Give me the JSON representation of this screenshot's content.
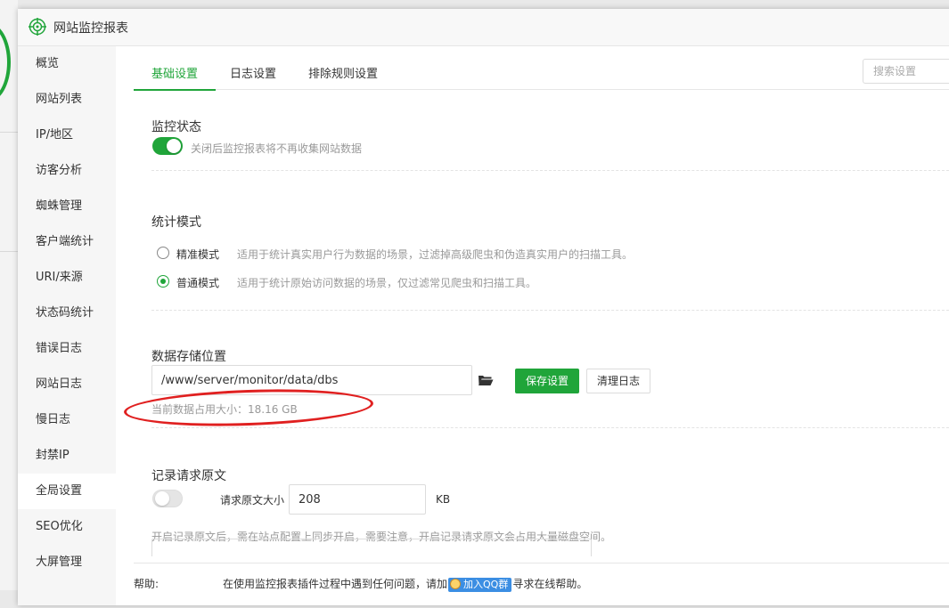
{
  "window": {
    "title": "网站监控报表"
  },
  "sidebar": {
    "items": [
      {
        "label": "概览"
      },
      {
        "label": "网站列表"
      },
      {
        "label": "IP/地区"
      },
      {
        "label": "访客分析"
      },
      {
        "label": "蜘蛛管理"
      },
      {
        "label": "客户端统计"
      },
      {
        "label": "URI/来源"
      },
      {
        "label": "状态码统计"
      },
      {
        "label": "错误日志"
      },
      {
        "label": "网站日志"
      },
      {
        "label": "慢日志"
      },
      {
        "label": "封禁IP"
      },
      {
        "label": "全局设置"
      },
      {
        "label": "SEO优化"
      },
      {
        "label": "大屏管理"
      }
    ],
    "active": "全局设置"
  },
  "tabs": [
    {
      "label": "基础设置",
      "active": true
    },
    {
      "label": "日志设置",
      "active": false
    },
    {
      "label": "排除规则设置",
      "active": false
    }
  ],
  "search": {
    "placeholder": "搜索设置"
  },
  "monitor": {
    "title": "监控状态",
    "enabled": true,
    "hint": "关闭后监控报表将不再收集网站数据"
  },
  "mode": {
    "title": "统计模式",
    "options": [
      {
        "label": "精准模式",
        "desc": "适用于统计真实用户行为数据的场景，过滤掉高级爬虫和伪造真实用户的扫描工具。",
        "checked": false
      },
      {
        "label": "普通模式",
        "desc": "适用于统计原始访问数据的场景，仅过滤常见爬虫和扫描工具。",
        "checked": true
      }
    ]
  },
  "storage": {
    "title": "数据存储位置",
    "path": "/www/server/monitor/data/dbs",
    "save_label": "保存设置",
    "clear_label": "清理日志",
    "usage_text": "当前数据占用大小：18.16 GB"
  },
  "request_log": {
    "title": "记录请求原文",
    "enabled": false,
    "size_label": "请求原文大小",
    "size_value": "208",
    "unit": "KB",
    "hint": "开启记录原文后，需在站点配置上同步开启，需要注意，开启记录请求原文会占用大量磁盘空间。"
  },
  "help": {
    "label": "帮助:",
    "text_before": "在使用监控报表插件过程中遇到任何问题，请加",
    "badge": "加入QQ群",
    "text_after": "寻求在线帮助。"
  },
  "colors": {
    "accent": "#20a53a",
    "annotation": "#e02020"
  }
}
